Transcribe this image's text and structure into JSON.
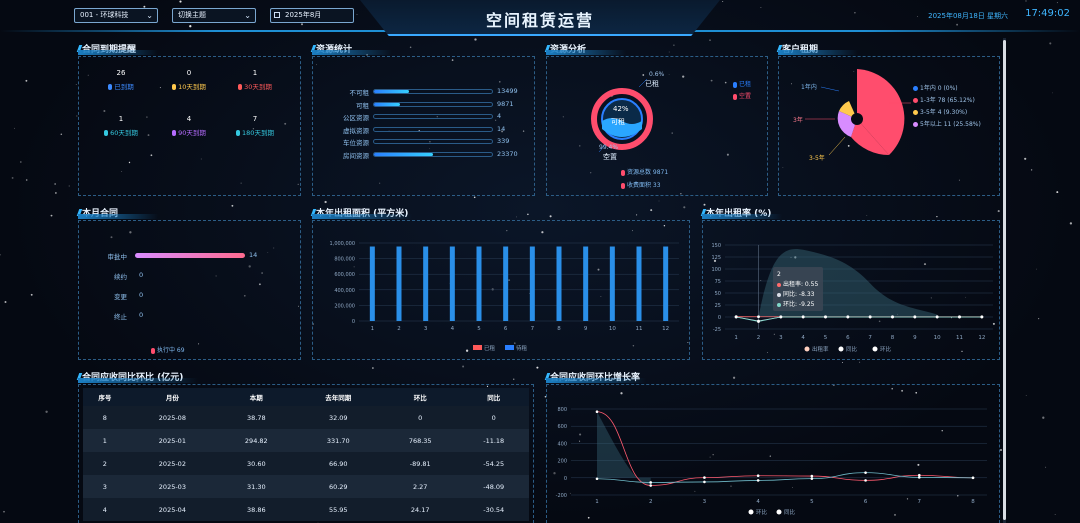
{
  "header": {
    "company": "001 - 环球科技",
    "theme": "切换主题",
    "month": "2025年8月",
    "title": "空间租赁运营",
    "date": "2025年08月18日 星期六",
    "time": "17:49:02"
  },
  "contract_reminder": {
    "title": "合同到期提醒",
    "items": [
      {
        "count": "26",
        "label": "已到期",
        "color": "#3d8bff"
      },
      {
        "count": "0",
        "label": "10天到期",
        "color": "#ffc94d"
      },
      {
        "count": "1",
        "label": "30天到期",
        "color": "#ff5a5a"
      },
      {
        "count": "1",
        "label": "60天到期",
        "color": "#35c9e0"
      },
      {
        "count": "4",
        "label": "90天到期",
        "color": "#b66cff"
      },
      {
        "count": "7",
        "label": "180天到期",
        "color": "#35c9e0"
      }
    ]
  },
  "resource_stats": {
    "title": "资源统计",
    "rows": [
      {
        "label": "不可租",
        "value": "13499",
        "fill": 0.3
      },
      {
        "label": "可租",
        "value": "9871",
        "fill": 0.22
      },
      {
        "label": "公区资源",
        "value": "4",
        "fill": 0
      },
      {
        "label": "虚拟资源",
        "value": "14",
        "fill": 0
      },
      {
        "label": "车位资源",
        "value": "339",
        "fill": 0
      },
      {
        "label": "房间资源",
        "value": "23370",
        "fill": 0.5
      }
    ]
  },
  "resource_analysis": {
    "title": "资源分析",
    "center_pct": "42%",
    "center_label": "可租",
    "top_pct": "0.6%",
    "top_label": "已租",
    "bottom_pct": "99.4%",
    "bottom_label": "空置",
    "legend": [
      {
        "label": "已租",
        "color": "#2a7fff"
      },
      {
        "label": "空置",
        "color": "#ff4d6d"
      }
    ],
    "total_label": "资源总数 9871",
    "income_label": "收费面积 33"
  },
  "tenant_term": {
    "title": "客户租期",
    "legend": [
      {
        "label": "1年内 0 (0%)",
        "color": "#2a7fff"
      },
      {
        "label": "1-3年 78 (65.12%)",
        "color": "#ff4d6d"
      },
      {
        "label": "3-5年 4 (9.30%)",
        "color": "#ffc94d"
      },
      {
        "label": "5年以上 11 (25.58%)",
        "color": "#d88cff"
      }
    ],
    "pie_labels": [
      "1年内",
      "3年",
      "3-5年"
    ]
  },
  "month_contract": {
    "title": "本月合同",
    "rows": [
      {
        "label": "审批中",
        "value": "14",
        "fill": 1
      },
      {
        "label": "续约",
        "value": "0",
        "fill": 0
      },
      {
        "label": "变更",
        "value": "0",
        "fill": 0
      },
      {
        "label": "终止",
        "value": "0",
        "fill": 0
      }
    ],
    "footer": "执行中 69"
  },
  "rent_area": {
    "title": "本年出租面积 (平方米)",
    "yticks": [
      "1,000,000",
      "800,000",
      "600,000",
      "400,000",
      "200,000",
      "0"
    ],
    "legend": [
      {
        "label": "已租",
        "color": "#ff5a5a"
      },
      {
        "label": "待租",
        "color": "#2a7fff"
      }
    ]
  },
  "rent_rate": {
    "title": "本年出租率 (%)",
    "yticks": [
      "150",
      "125",
      "100",
      "75",
      "50",
      "25",
      "0",
      "-25"
    ],
    "tooltip": {
      "title": "2",
      "row1": "出租率: 0.55",
      "row2": "同比: -8.33",
      "row3": "环比: -9.25"
    },
    "legend": [
      {
        "label": "出租率",
        "color": "#ffd0c0"
      },
      {
        "label": "同比",
        "color": "#ffffff"
      },
      {
        "label": "环比",
        "color": "#ffffff"
      }
    ]
  },
  "receivable_table": {
    "title": "合同应收同比环比 (亿元)",
    "headers": [
      "序号",
      "月份",
      "本期",
      "去年同期",
      "环比",
      "同比"
    ],
    "rows": [
      [
        "8",
        "2025-08",
        "38.78",
        "32.09",
        "0",
        "0"
      ],
      [
        "1",
        "2025-01",
        "294.82",
        "331.70",
        "768.35",
        "-11.18"
      ],
      [
        "2",
        "2025-02",
        "30.60",
        "66.90",
        "-89.81",
        "-54.25"
      ],
      [
        "3",
        "2025-03",
        "31.30",
        "60.29",
        "2.27",
        "-48.09"
      ],
      [
        "4",
        "2025-04",
        "38.86",
        "55.95",
        "24.17",
        "-30.54"
      ]
    ]
  },
  "growth": {
    "title": "合同应收同环比增长率",
    "yticks": [
      "800",
      "600",
      "400",
      "200",
      "0",
      "-200"
    ],
    "legend": [
      {
        "label": "环比",
        "color": "#ffffff"
      },
      {
        "label": "同比",
        "color": "#ffffff"
      }
    ]
  },
  "chart_data": [
    {
      "type": "bar",
      "title": "本年出租面积 (平方米)",
      "categories": [
        "1",
        "2",
        "3",
        "4",
        "5",
        "6",
        "7",
        "8",
        "9",
        "10",
        "11",
        "12"
      ],
      "series": [
        {
          "name": "已租",
          "values": [
            0,
            0,
            0,
            0,
            0,
            0,
            0,
            0,
            0,
            0,
            0,
            0
          ]
        },
        {
          "name": "待租",
          "values": [
            955000,
            955000,
            955000,
            955000,
            955000,
            955000,
            955000,
            955000,
            955000,
            955000,
            955000,
            955000
          ]
        }
      ],
      "ylim": [
        0,
        1000000
      ]
    },
    {
      "type": "line",
      "title": "本年出租率 (%)",
      "x": [
        "1",
        "2",
        "3",
        "4",
        "5",
        "6",
        "7",
        "8",
        "9",
        "10",
        "11",
        "12"
      ],
      "series": [
        {
          "name": "出租率",
          "values": [
            0.6,
            0.55,
            0.5,
            0.5,
            0.5,
            0.5,
            0.5,
            0.5,
            0.5,
            0.5,
            0.5,
            0.5
          ]
        },
        {
          "name": "同比",
          "values": [
            0,
            -8.33,
            0,
            0,
            0,
            0,
            0,
            0,
            0,
            0,
            0,
            0
          ]
        },
        {
          "name": "环比",
          "values": [
            0,
            -9.25,
            0,
            0,
            0,
            0,
            0,
            0,
            0,
            0,
            0,
            0
          ]
        }
      ],
      "ylim": [
        -25,
        150
      ]
    },
    {
      "type": "line",
      "title": "合同应收同环比增长率",
      "x": [
        "1",
        "2",
        "3",
        "4",
        "5",
        "6",
        "7",
        "8"
      ],
      "series": [
        {
          "name": "环比",
          "values": [
            768.35,
            -89.81,
            2.27,
            24.17,
            20,
            -30,
            30,
            0
          ]
        },
        {
          "name": "同比",
          "values": [
            -11.18,
            -54.25,
            -48.09,
            -30.54,
            -10,
            60,
            5,
            0
          ]
        }
      ],
      "ylim": [
        -200,
        800
      ]
    }
  ]
}
